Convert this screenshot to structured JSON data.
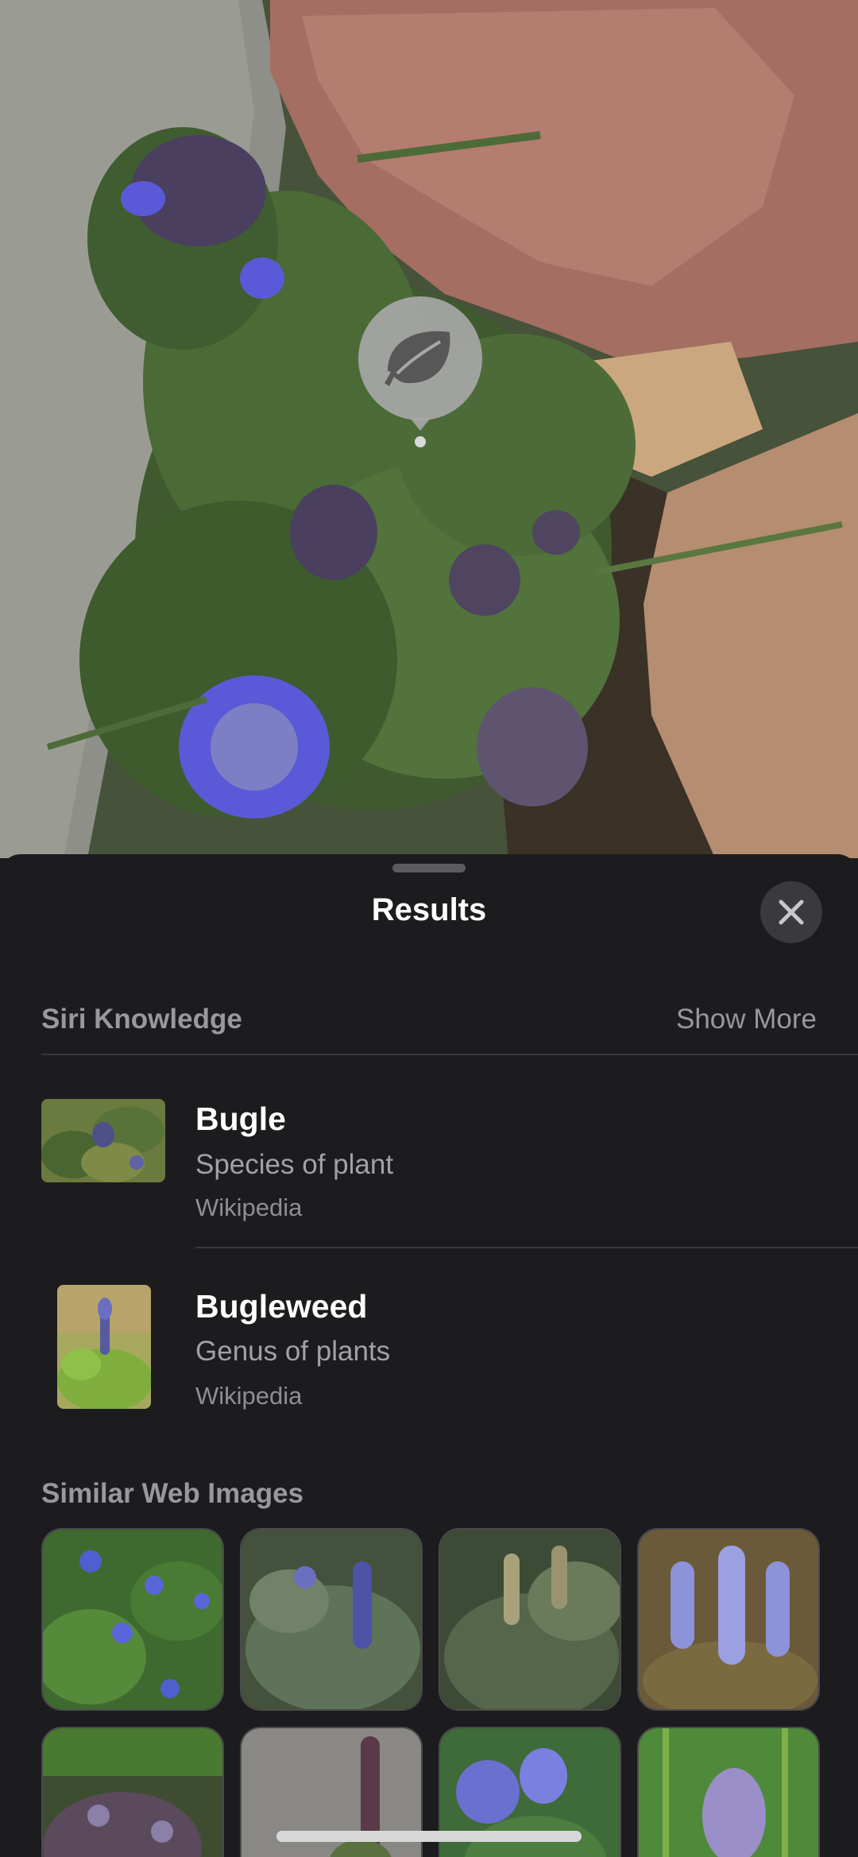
{
  "sheet": {
    "title": "Results"
  },
  "siri_knowledge": {
    "header": "Siri Knowledge",
    "show_more": "Show More",
    "results": [
      {
        "title": "Bugle",
        "subtitle": "Species of plant",
        "source": "Wikipedia"
      },
      {
        "title": "Bugleweed",
        "subtitle": "Genus of plants",
        "source": "Wikipedia"
      }
    ]
  },
  "similar_images": {
    "header": "Similar Web Images"
  },
  "icons": {
    "lookup": "leaf-icon",
    "close": "close-icon"
  },
  "colors": {
    "sheet_background": "#1c1c1e",
    "flower": "#5a5ad8"
  }
}
